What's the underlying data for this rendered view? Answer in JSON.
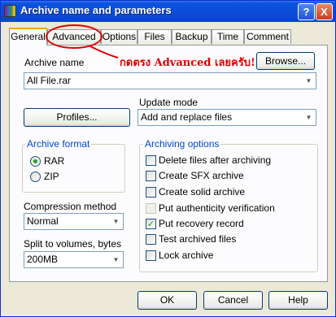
{
  "window": {
    "title": "Archive name and parameters",
    "help_label": "?",
    "close_label": "X"
  },
  "tabs": [
    {
      "label": "General"
    },
    {
      "label": "Advanced"
    },
    {
      "label": "Options"
    },
    {
      "label": "Files"
    },
    {
      "label": "Backup"
    },
    {
      "label": "Time"
    },
    {
      "label": "Comment"
    }
  ],
  "general": {
    "archive_name_label": "Archive name",
    "browse_label": "Browse...",
    "archive_name_value": "All File.rar",
    "update_mode_label": "Update mode",
    "profiles_label": "Profiles...",
    "update_mode_value": "Add and replace files",
    "archive_format": {
      "title": "Archive format",
      "options": [
        {
          "label": "RAR",
          "selected": true
        },
        {
          "label": "ZIP",
          "selected": false
        }
      ]
    },
    "archiving_options": {
      "title": "Archiving options",
      "items": [
        {
          "label": "Delete files after archiving",
          "checked": false
        },
        {
          "label": "Create SFX archive",
          "checked": false
        },
        {
          "label": "Create solid archive",
          "checked": false
        },
        {
          "label": "Put authenticity verification",
          "checked": false
        },
        {
          "label": "Put recovery record",
          "checked": true
        },
        {
          "label": "Test archived files",
          "checked": false
        },
        {
          "label": "Lock archive",
          "checked": false
        }
      ]
    },
    "compression_label": "Compression method",
    "compression_value": "Normal",
    "split_label": "Split to volumes, bytes",
    "split_value": "200MB"
  },
  "footer": {
    "ok_label": "OK",
    "cancel_label": "Cancel",
    "help_label": "Help"
  },
  "annotation": {
    "text": "กดตรง Advanced เลยครับ!"
  },
  "colors": {
    "accent_blue": "#0046d5",
    "annotation_red": "#e00000",
    "check_green": "#21a121"
  }
}
